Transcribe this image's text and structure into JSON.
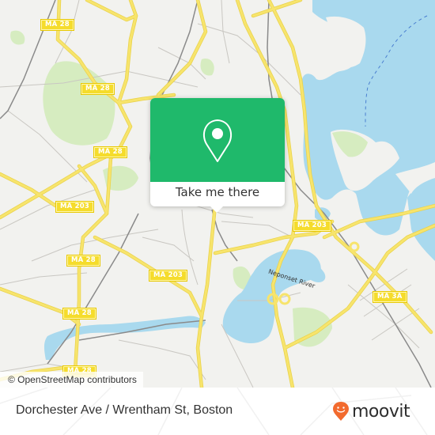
{
  "map": {
    "colors": {
      "land": "#f2f2ef",
      "water": "#a9d9ee",
      "park": "#d6ecc0",
      "road_major": "#f7e46c",
      "road_minor": "#c9c7c2",
      "rail": "#8a8a8a",
      "ferry": "#4a7fd0"
    },
    "route_shields": [
      {
        "label": "MA 28"
      },
      {
        "label": "MA 28"
      },
      {
        "label": "MA 28"
      },
      {
        "label": "MA 203"
      },
      {
        "label": "MA 28"
      },
      {
        "label": "MA 203"
      },
      {
        "label": "MA 203"
      },
      {
        "label": "MA 28"
      },
      {
        "label": "MA 3A"
      },
      {
        "label": "MA 28"
      }
    ],
    "river_label": "Neponset River",
    "attribution": "© OpenStreetMap contributors"
  },
  "popup": {
    "icon": "map-pin-icon",
    "button_label": "Take me there",
    "accent": "#1fb96b"
  },
  "footer": {
    "stop_title": "Dorchester Ave / Wrentham St, Boston",
    "brand": "moovit",
    "brand_color": "#f26a2e"
  }
}
